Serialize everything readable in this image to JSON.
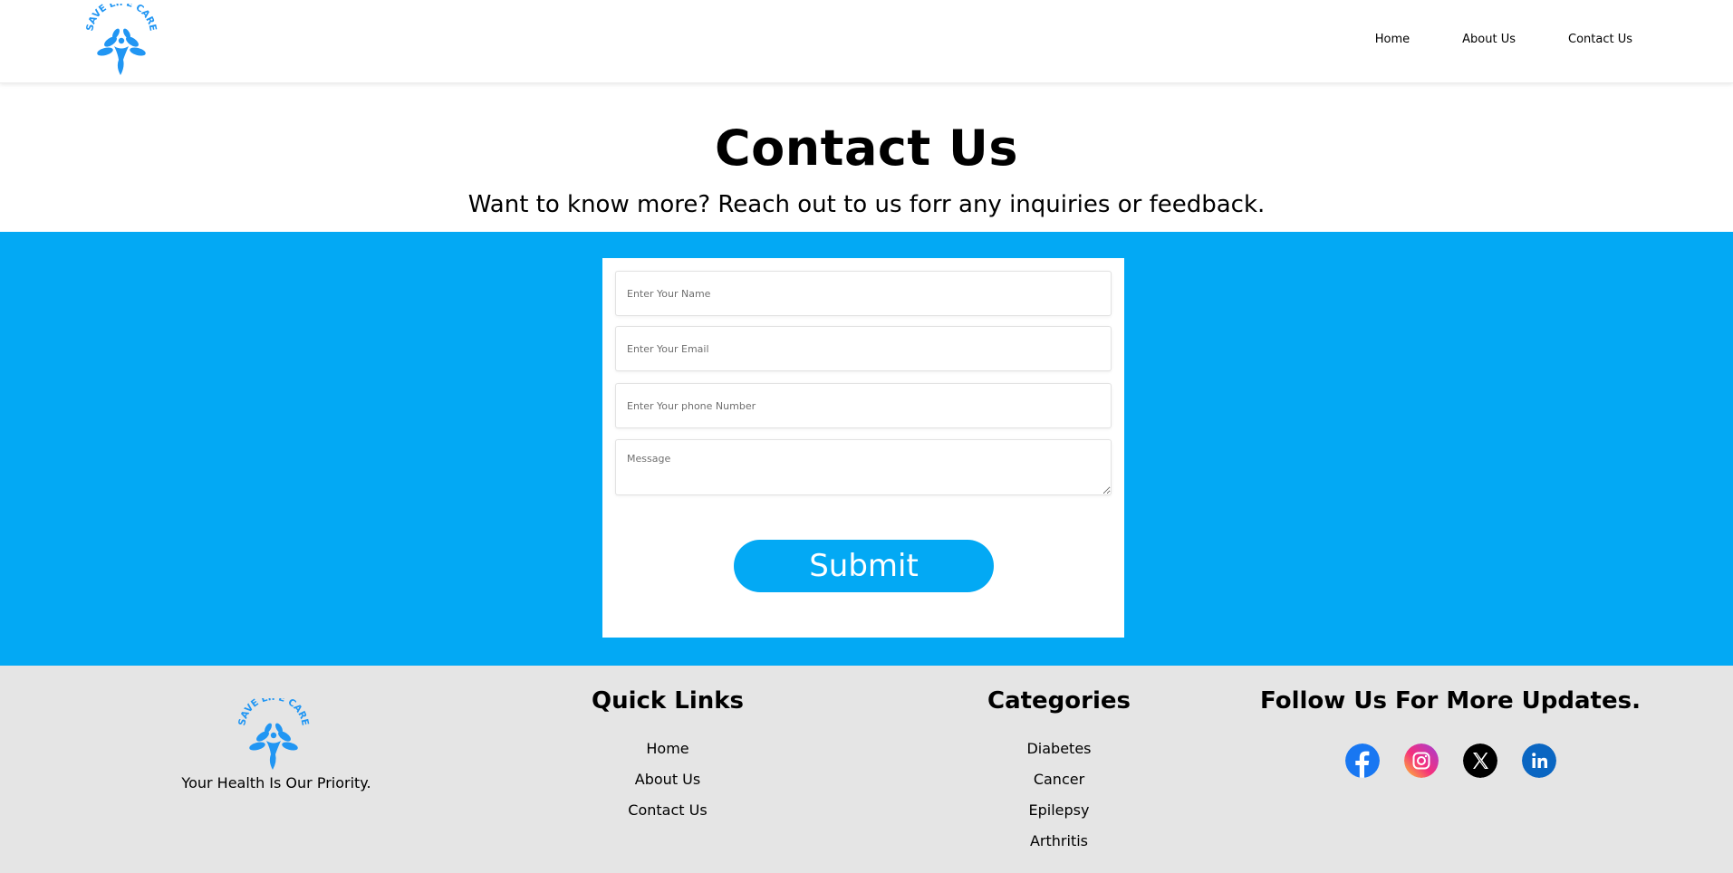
{
  "brand": {
    "logo_text": "SAVE LIFE CARE",
    "logo_color": "#2196f3"
  },
  "nav": {
    "items": [
      {
        "label": "Home"
      },
      {
        "label": "About Us"
      },
      {
        "label": "Contact Us"
      }
    ]
  },
  "hero": {
    "title": "Contact Us",
    "subtitle": "Want to know more? Reach out to us forr any inquiries or feedback."
  },
  "form": {
    "name_placeholder": "Enter Your Name",
    "email_placeholder": "Enter Your Email",
    "phone_placeholder": "Enter Your phone Number",
    "message_placeholder": "Message",
    "submit_label": "Submit",
    "accent_color": "#03a9f4"
  },
  "footer": {
    "tagline": "Your Health Is Our Priority.",
    "quick_links": {
      "heading": "Quick Links",
      "items": [
        "Home",
        "About Us",
        "Contact Us"
      ]
    },
    "categories": {
      "heading": "Categories",
      "items": [
        "Diabetes",
        "Cancer",
        "Epilepsy",
        "Arthritis"
      ]
    },
    "social": {
      "heading": "Follow Us For More Updates.",
      "icons": [
        "facebook-icon",
        "instagram-icon",
        "x-twitter-icon",
        "linkedin-icon"
      ]
    }
  }
}
